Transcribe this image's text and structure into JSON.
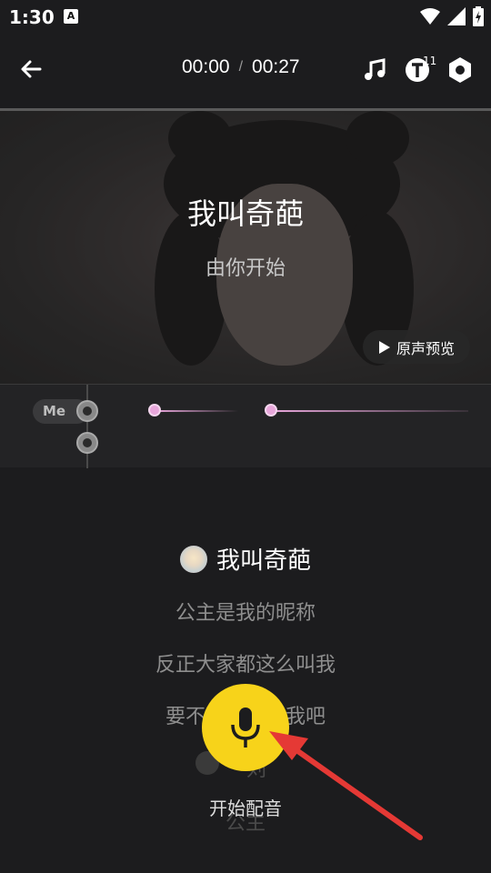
{
  "status": {
    "time": "1:30",
    "a_label": "A"
  },
  "header": {
    "current_time": "00:00",
    "separator": "/",
    "total_time": "00:27",
    "badge_count": "11"
  },
  "video": {
    "title": "我叫奇葩",
    "subtitle": "由你开始",
    "preview_label": "原声预览"
  },
  "timeline": {
    "me_label": "Me"
  },
  "lyrics": {
    "current": "我叫奇葩",
    "lines": [
      "公主是我的昵称",
      "反正大家都这么叫我",
      "要不然你也叫我吧"
    ],
    "hidden_a": "公主",
    "hidden_b": "刘"
  },
  "record": {
    "start_label": "开始配音"
  },
  "colors": {
    "accent": "#f7d31a",
    "arrow": "#e53935",
    "track": "#e8a6db"
  }
}
